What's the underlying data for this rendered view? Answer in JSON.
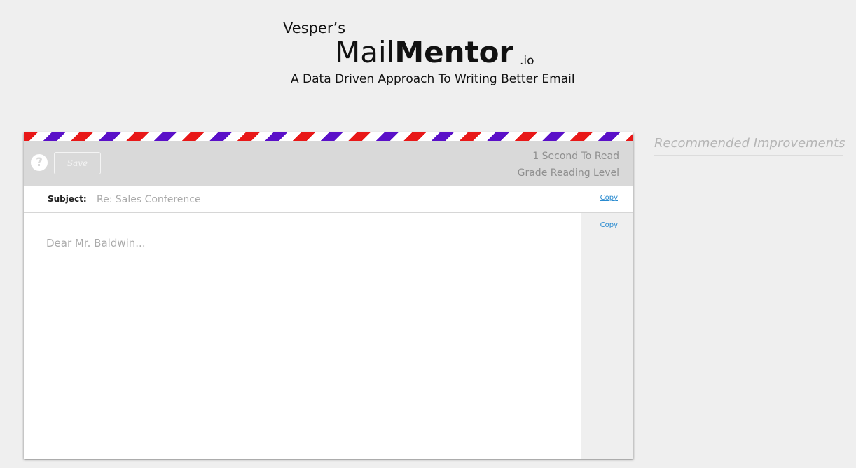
{
  "logo": {
    "vespers": "Vesper’s",
    "mail": "Mail",
    "mentor": "Mentor",
    "io": ".io",
    "tagline": "A Data Driven Approach To Writing Better Email"
  },
  "toolbar": {
    "help_icon": "question-icon",
    "help_glyph": "?",
    "save_label": "Save",
    "read_time": "1 Second To Read",
    "grade_level": "Grade Reading Level"
  },
  "subject": {
    "label": "Subject:",
    "placeholder": "Re: Sales Conference",
    "copy_label": "Copy"
  },
  "body": {
    "placeholder": "Dear Mr. Baldwin...",
    "copy_label": "Copy"
  },
  "recommendations": {
    "title": "Recommended Improvements"
  },
  "colors": {
    "stripe_red": "#e81818",
    "stripe_purple": "#5a10c8",
    "link": "#2a8bd0",
    "toolbar_bg": "#d9d9d9"
  }
}
